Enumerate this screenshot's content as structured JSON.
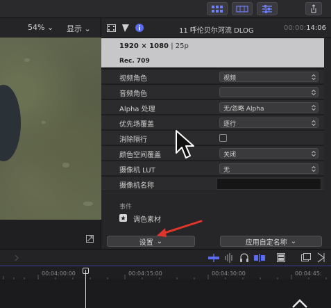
{
  "viewer": {
    "zoom": "54%",
    "zoom_chevron": "⌄",
    "display_label": "显示",
    "display_chevron": "⌄"
  },
  "inspector": {
    "clip_title": "11 呼伦贝尔河流 DLOG",
    "timecode_dim": "00:00:",
    "timecode": "14:06",
    "format_resolution": "1920 × 1080",
    "format_rate": " | 25p",
    "color_space": "Rec. 709"
  },
  "properties": [
    {
      "label": "视频角色",
      "type": "popup",
      "value": "视频"
    },
    {
      "label": "音频角色",
      "type": "popup",
      "value": ""
    },
    {
      "label": "Alpha 处理",
      "type": "popup",
      "value": "无/忽略 Alpha"
    },
    {
      "label": "优先场覆盖",
      "type": "popup",
      "value": "逐行"
    },
    {
      "label": "消除隔行",
      "type": "checkbox",
      "value": ""
    },
    {
      "label": "颜色空间覆盖",
      "type": "popup",
      "value": "关闭"
    },
    {
      "label": "摄像机 LUT",
      "type": "popup",
      "value": "无"
    },
    {
      "label": "摄像机名称",
      "type": "text",
      "value": ""
    }
  ],
  "event": {
    "section_label": "事件",
    "item_label": "调色素材"
  },
  "footer": {
    "settings_label": "设置",
    "settings_chevron": "⌄",
    "apply_name_label": "应用自定名称",
    "apply_name_chevron": "⌄"
  },
  "timeline": {
    "timecodes": [
      "00:04:00:00",
      "00:04:15:00",
      "00:04:30:00",
      "00:04:45:"
    ]
  },
  "colors": {
    "accent_blue": "#5a6cf0",
    "annotation_red": "#e0352b"
  }
}
